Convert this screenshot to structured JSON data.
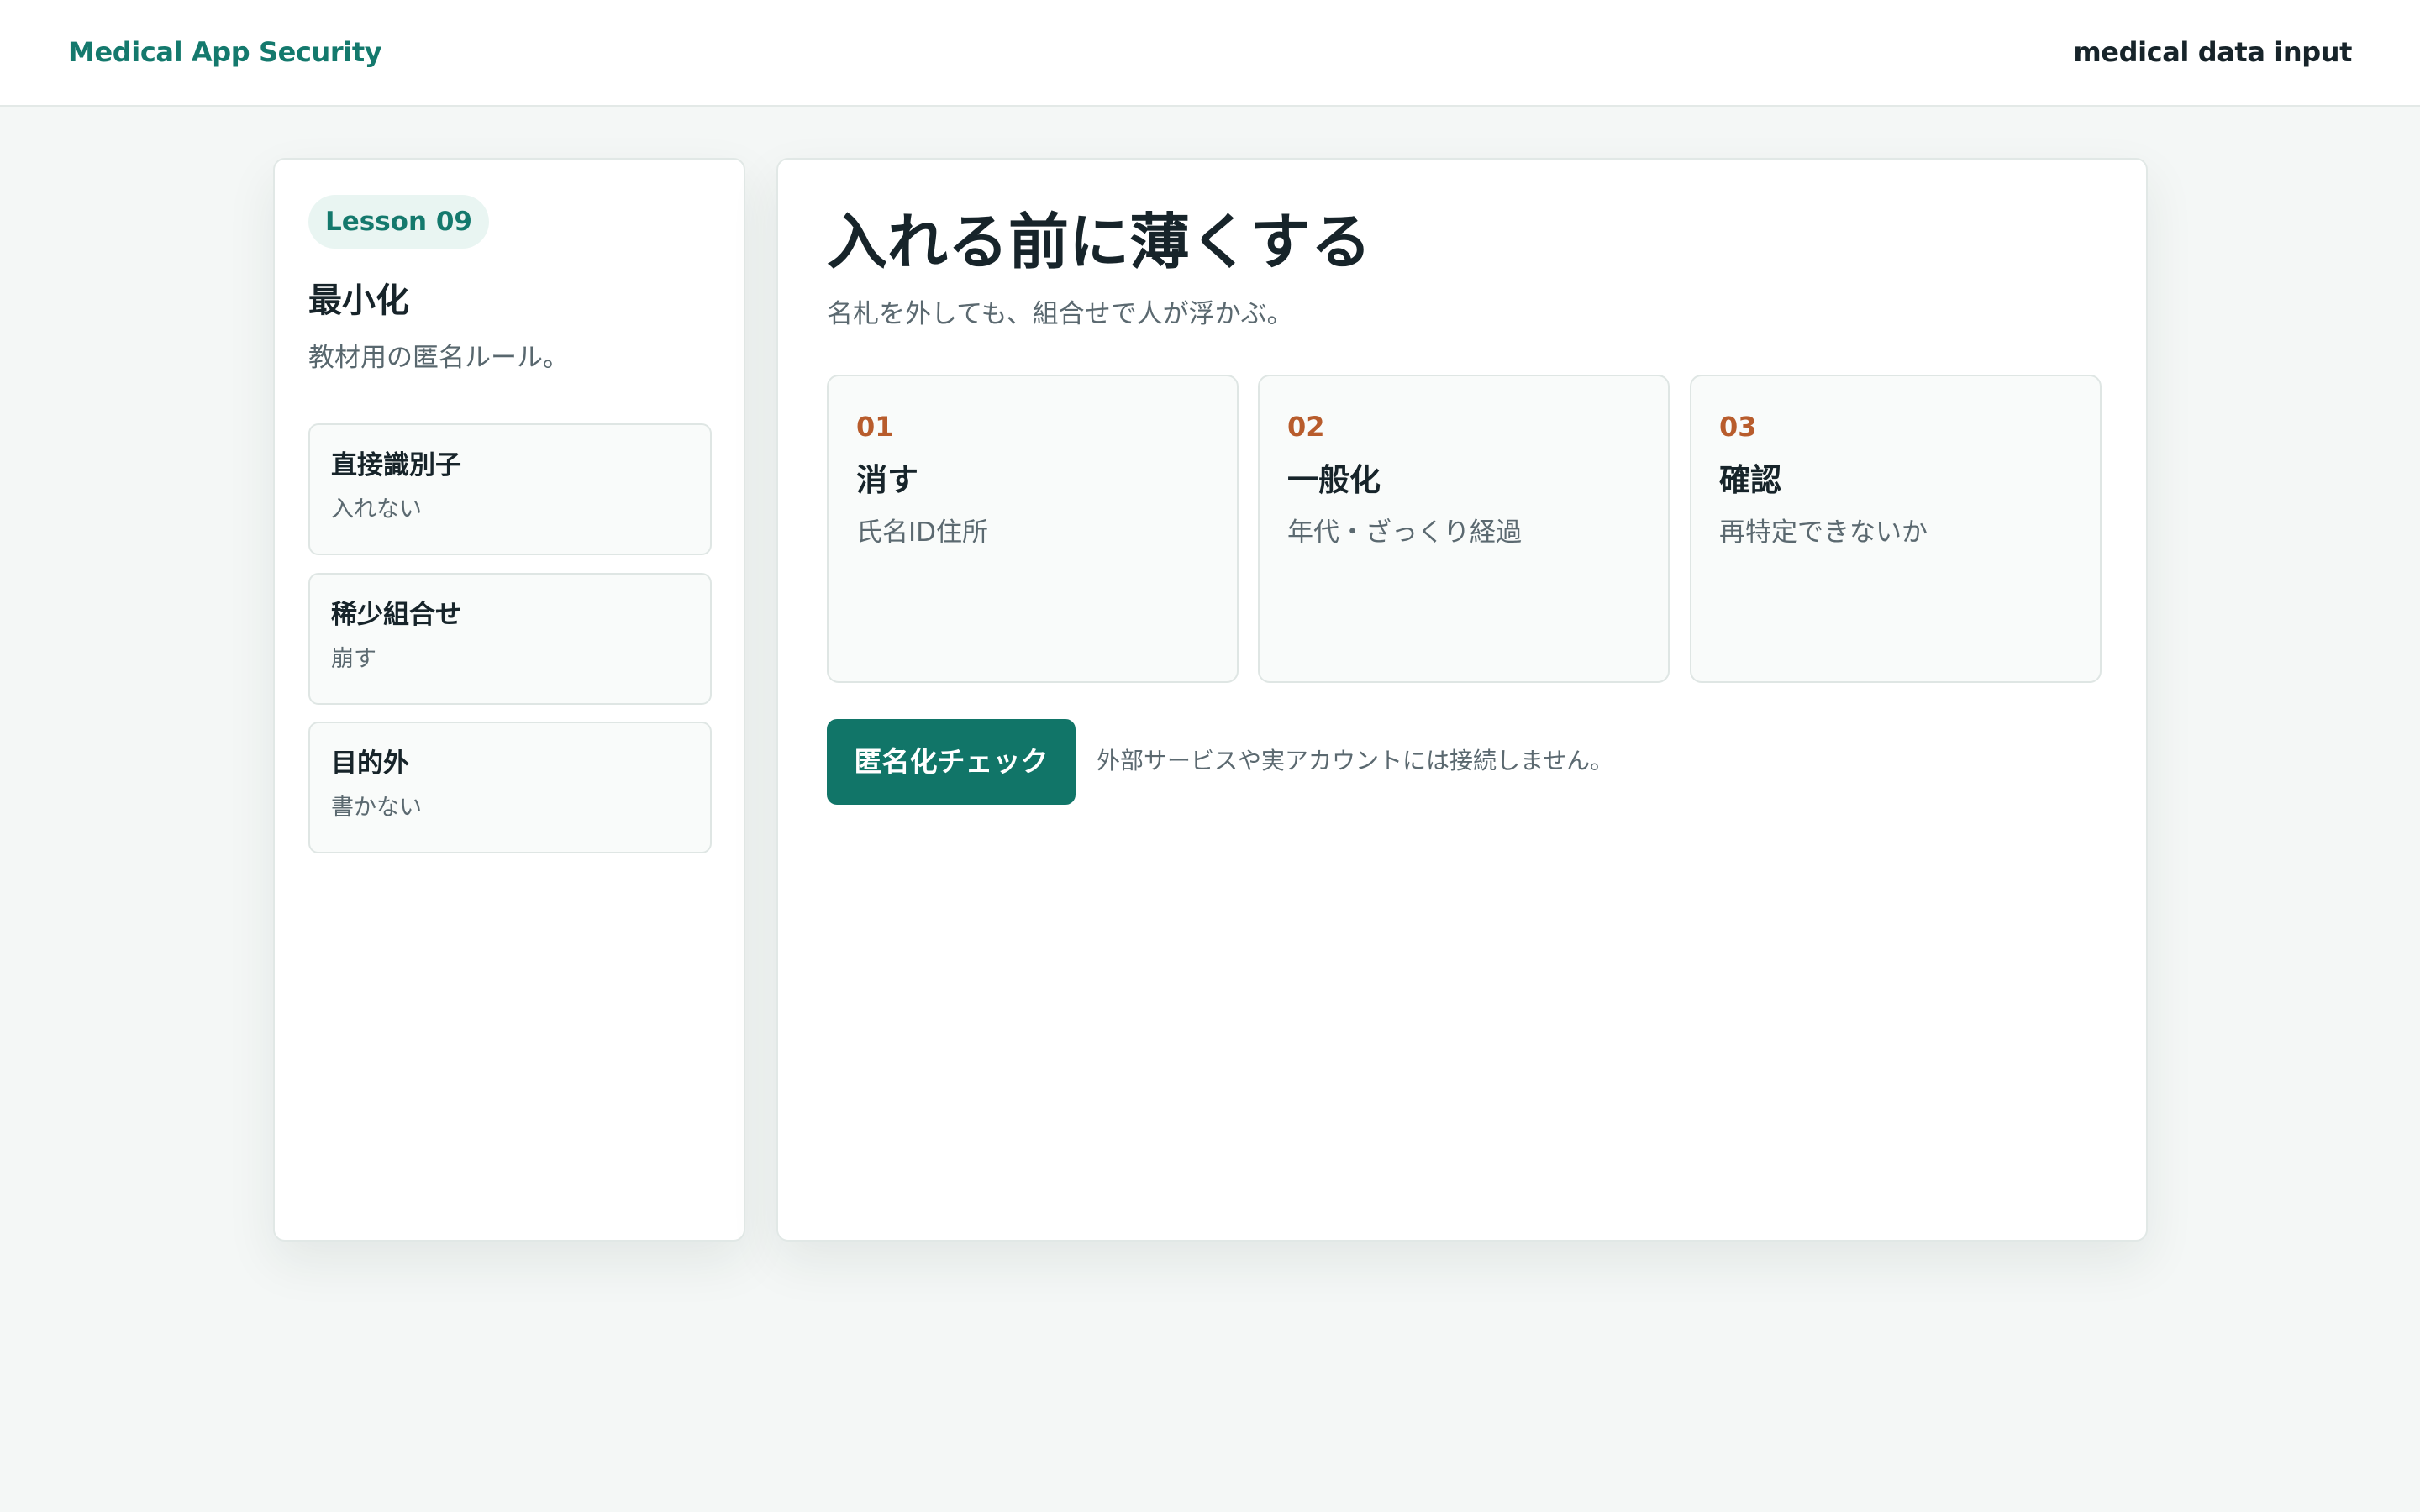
{
  "header": {
    "brand": "Medical App Security",
    "right_label": "medical data input"
  },
  "sidebar": {
    "lesson": "Lesson 09",
    "title": "最小化",
    "subtitle": "教材用の匿名ルール。",
    "items": [
      {
        "title": "直接識別子",
        "subtitle": "入れない"
      },
      {
        "title": "稀少組合せ",
        "subtitle": "崩す"
      },
      {
        "title": "目的外",
        "subtitle": "書かない"
      }
    ]
  },
  "main": {
    "title": "入れる前に薄くする",
    "subtitle": "名札を外しても、組合せで人が浮かぶ。",
    "steps": [
      {
        "number": "01",
        "title": "消す",
        "subtitle": "氏名ID住所"
      },
      {
        "number": "02",
        "title": "一般化",
        "subtitle": "年代・ざっくり経過"
      },
      {
        "number": "03",
        "title": "確認",
        "subtitle": "再特定できないか"
      }
    ],
    "button_label": "匿名化チェック",
    "button_note": "外部サービスや実アカウントには接続しません。"
  },
  "colors": {
    "accent": "#117568",
    "step_number": "#b85c2c",
    "background": "#f4f7f6"
  }
}
